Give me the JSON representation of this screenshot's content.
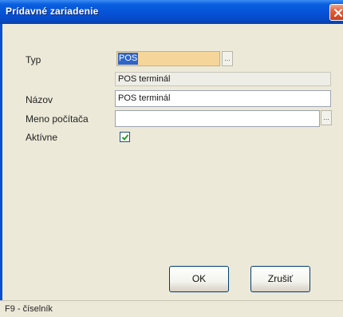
{
  "window": {
    "title": "Prídavné zariadenie"
  },
  "form": {
    "typ": {
      "label": "Typ",
      "value": "POS",
      "description": "POS terminál"
    },
    "nazov": {
      "label": "Názov",
      "value": "POS terminál"
    },
    "meno_pocitaca": {
      "label": "Meno počítača",
      "value": ""
    },
    "aktivne": {
      "label": "Aktívne",
      "checked": true
    },
    "ellipsis": "..."
  },
  "buttons": {
    "ok": "OK",
    "cancel": "Zrušiť"
  },
  "status": {
    "hint": "F9 - číselník"
  },
  "colors": {
    "titlebar": "#0652d6",
    "dialog_bg": "#ece9d8",
    "selection": "#2f64c8",
    "combo_highlight": "#f5d59a"
  }
}
